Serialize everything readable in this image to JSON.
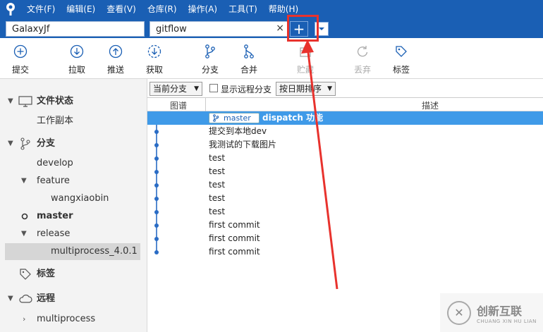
{
  "menubar": {
    "items": [
      "文件(F)",
      "编辑(E)",
      "查看(V)",
      "仓库(R)",
      "操作(A)",
      "工具(T)",
      "帮助(H)"
    ]
  },
  "tabs": {
    "items": [
      "GalaxyJf",
      "gitflow"
    ],
    "close_glyph": "×",
    "add_glyph": "+"
  },
  "toolbar": {
    "commit": "提交",
    "pull": "拉取",
    "push": "推送",
    "fetch": "获取",
    "branch": "分支",
    "merge": "合并",
    "stash": "贮藏",
    "discard": "丢弃",
    "tag": "标签"
  },
  "sidebar": {
    "file_status": "文件状态",
    "working_copy": "工作副本",
    "branches": "分支",
    "develop": "develop",
    "feature": "feature",
    "wangxiaobin": "wangxiaobin",
    "master": "master",
    "release": "release",
    "multiprocess_401": "multiprocess_4.0.1",
    "tags": "标签",
    "remotes": "远程",
    "multiprocess": "multiprocess"
  },
  "filters": {
    "branch_filter": "当前分支",
    "show_remote": "显示远程分支",
    "sort": "按日期排序"
  },
  "columns": {
    "graph": "图谱",
    "description": "描述"
  },
  "commits": {
    "selected_branch": "master",
    "selected_message": "dispatch 功能",
    "messages": [
      "提交到本地dev",
      "我测试的下载图片",
      "test",
      "test",
      "test",
      "test",
      "test",
      "first commit",
      "first commit",
      "first commit"
    ]
  },
  "watermark": {
    "cn": "创新互联",
    "en": "CHUANG XIN HU LIAN"
  },
  "colors": {
    "menubar": "#1a5fb4",
    "selection": "#3f9ae8",
    "annotation": "#e8322d"
  }
}
